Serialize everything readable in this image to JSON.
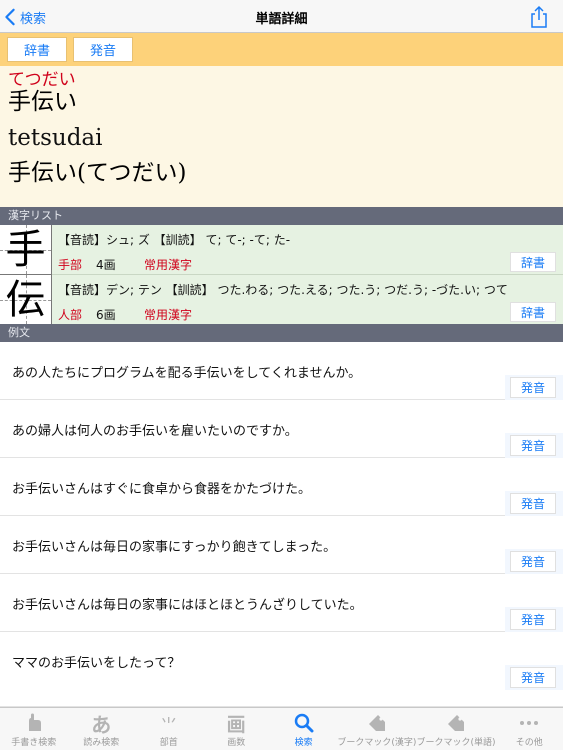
{
  "nav": {
    "back_label": "検索",
    "title": "単語詳細"
  },
  "toolbar": {
    "dict_label": "辞書",
    "sound_label": "発音"
  },
  "word": {
    "reading": "てつだい",
    "headword": "手伝い",
    "romaji": "tetsudai",
    "full": "手伝い(てつだい)"
  },
  "sections": {
    "kanji_list": "漢字リスト",
    "examples": "例文"
  },
  "kanji": [
    {
      "char": "手",
      "readings": "【音読】シュ; ズ 【訓読】 て; て-; -て; た-",
      "radical": "手部",
      "strokes": "4画",
      "grade": "常用漢字",
      "dict_label": "辞書"
    },
    {
      "char": "伝",
      "readings": "【音読】デン; テン 【訓読】 つた.わる; つた.える; つた.う; つだ.う; -づた.い; つて",
      "radical": "人部",
      "strokes": "6画",
      "grade": "常用漢字",
      "dict_label": "辞書"
    }
  ],
  "examples": [
    {
      "text": "あの人たちにプログラムを配る手伝いをしてくれませんか。",
      "sound_label": "発音"
    },
    {
      "text": "あの婦人は何人のお手伝いを雇いたいのですか。",
      "sound_label": "発音"
    },
    {
      "text": "お手伝いさんはすぐに食卓から食器をかたづけた。",
      "sound_label": "発音"
    },
    {
      "text": "お手伝いさんは毎日の家事にすっかり飽きてしまった。",
      "sound_label": "発音"
    },
    {
      "text": "お手伝いさんは毎日の家事にはほとほとうんざりしていた。",
      "sound_label": "発音"
    },
    {
      "text": "ママのお手伝いをしたって？",
      "sound_label": "発音"
    }
  ],
  "tabs": [
    {
      "label": "手書き検索",
      "icon": "handwriting-icon",
      "active": false
    },
    {
      "label": "読み検索",
      "icon": "hiragana-a-icon",
      "active": false
    },
    {
      "label": "部首",
      "icon": "radical-icon",
      "active": false
    },
    {
      "label": "画数",
      "icon": "stroke-count-icon",
      "active": false
    },
    {
      "label": "検索",
      "icon": "search-icon",
      "active": true
    },
    {
      "label": "ブークマック(漢字)",
      "icon": "bookmark-tag-icon",
      "active": false
    },
    {
      "label": "ブークマック(単語)",
      "icon": "bookmark-tag-icon",
      "active": false
    },
    {
      "label": "その他",
      "icon": "more-icon",
      "active": false
    }
  ],
  "colors": {
    "accent": "#1a7cf5",
    "toolbar": "#fdd27a",
    "header_bg": "#fdf7e4",
    "kanji_bg": "#e6f2e2",
    "section_bg": "#656a7a",
    "highlight_red": "#d0021b"
  }
}
